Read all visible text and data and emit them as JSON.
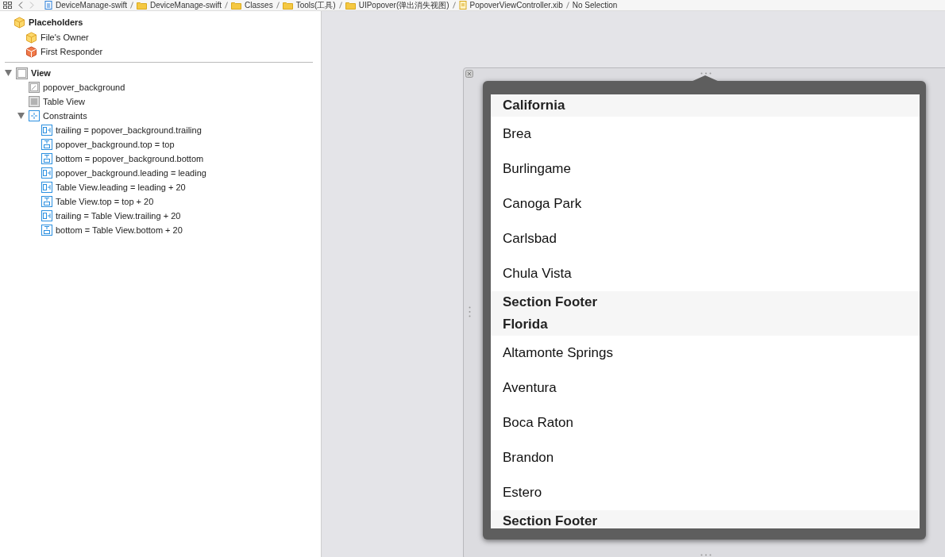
{
  "breadcrumbs": [
    {
      "label": "DeviceManage-swift",
      "kind": "project"
    },
    {
      "label": "DeviceManage-swift",
      "kind": "folder"
    },
    {
      "label": "Classes",
      "kind": "folder"
    },
    {
      "label": "Tools(工具)",
      "kind": "folder"
    },
    {
      "label": "UIPopover(弹出消失视图)",
      "kind": "folder"
    },
    {
      "label": "PopoverViewController.xib",
      "kind": "file"
    },
    {
      "label": "No Selection",
      "kind": "none"
    }
  ],
  "outline": {
    "placeholders": {
      "label": "Placeholders",
      "items": [
        {
          "label": "File's Owner",
          "kind": "owner"
        },
        {
          "label": "First Responder",
          "kind": "responder"
        }
      ]
    },
    "tree": [
      {
        "label": "View",
        "kind": "view",
        "expanded": true,
        "children": [
          {
            "label": "popover_background",
            "kind": "image"
          },
          {
            "label": "Table View",
            "kind": "table"
          },
          {
            "label": "Constraints",
            "kind": "constraints",
            "expanded": true,
            "children": [
              {
                "label": "trailing = popover_background.trailing",
                "kind": "h-constraint"
              },
              {
                "label": "popover_background.top = top",
                "kind": "v-constraint"
              },
              {
                "label": "bottom = popover_background.bottom",
                "kind": "v-constraint"
              },
              {
                "label": "popover_background.leading = leading",
                "kind": "h-constraint"
              },
              {
                "label": "Table View.leading = leading + 20",
                "kind": "h-constraint"
              },
              {
                "label": "Table View.top = top + 20",
                "kind": "v-constraint"
              },
              {
                "label": "trailing = Table View.trailing + 20",
                "kind": "h-constraint"
              },
              {
                "label": "bottom = Table View.bottom + 20",
                "kind": "v-constraint"
              }
            ]
          }
        ]
      }
    ]
  },
  "table": [
    {
      "kind": "header",
      "label": "California"
    },
    {
      "kind": "row",
      "label": "Brea"
    },
    {
      "kind": "row",
      "label": "Burlingame"
    },
    {
      "kind": "row",
      "label": "Canoga Park"
    },
    {
      "kind": "row",
      "label": "Carlsbad"
    },
    {
      "kind": "row",
      "label": "Chula Vista"
    },
    {
      "kind": "footer",
      "label": "Section Footer"
    },
    {
      "kind": "header",
      "label": "Florida"
    },
    {
      "kind": "row",
      "label": "Altamonte Springs"
    },
    {
      "kind": "row",
      "label": "Aventura"
    },
    {
      "kind": "row",
      "label": "Boca Raton"
    },
    {
      "kind": "row",
      "label": "Brandon"
    },
    {
      "kind": "row",
      "label": "Estero"
    },
    {
      "kind": "footer",
      "label": "Section Footer"
    }
  ]
}
